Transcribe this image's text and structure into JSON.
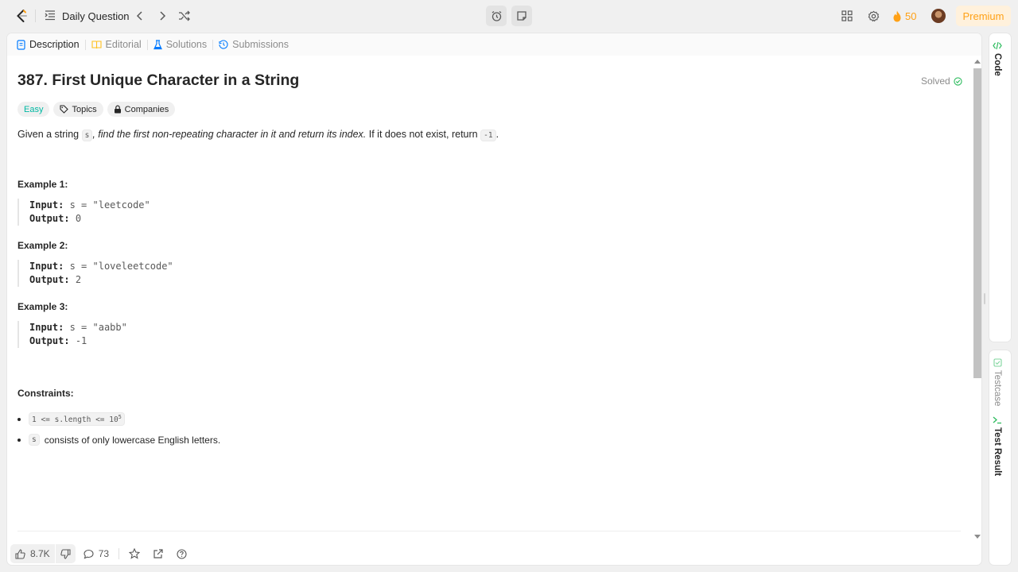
{
  "topbar": {
    "daily_label": "Daily Question",
    "streak_count": "50",
    "premium_label": "Premium"
  },
  "tabs": [
    {
      "label": "Description"
    },
    {
      "label": "Editorial"
    },
    {
      "label": "Solutions"
    },
    {
      "label": "Submissions"
    }
  ],
  "problem": {
    "title": "387. First Unique Character in a String",
    "solved_label": "Solved",
    "difficulty": "Easy",
    "topics_label": "Topics",
    "companies_label": "Companies",
    "desc_prefix": "Given a string",
    "desc_s": "s",
    "desc_italic": ", find the first non-repeating character in it and return its index.",
    "desc_suffix": " If it does not exist, return",
    "desc_neg1": "-1",
    "desc_end": ".",
    "examples": [
      {
        "heading": "Example 1:",
        "input_label": "Input:",
        "input": "s = \"leetcode\"",
        "output_label": "Output:",
        "output": "0"
      },
      {
        "heading": "Example 2:",
        "input_label": "Input:",
        "input": "s = \"loveleetcode\"",
        "output_label": "Output:",
        "output": "2"
      },
      {
        "heading": "Example 3:",
        "input_label": "Input:",
        "input": "s = \"aabb\"",
        "output_label": "Output:",
        "output": "-1"
      }
    ],
    "constraints_heading": "Constraints:",
    "constraint1_code": "1 <= s.length <= 10",
    "constraint1_sup": "5",
    "constraint2_code": "s",
    "constraint2_text": "consists of only lowercase English letters."
  },
  "footer": {
    "likes": "8.7K",
    "comments": "73"
  },
  "side": {
    "code_label": "Code",
    "testcase_label": "Testcase",
    "testresult_label": "Test Result"
  },
  "colors": {
    "accent": "#ffa116",
    "easy": "#00b8a3",
    "solved_check": "#2cbb5d",
    "tab_description_icon": "#007aff",
    "code_icon": "#2cbb5d"
  }
}
